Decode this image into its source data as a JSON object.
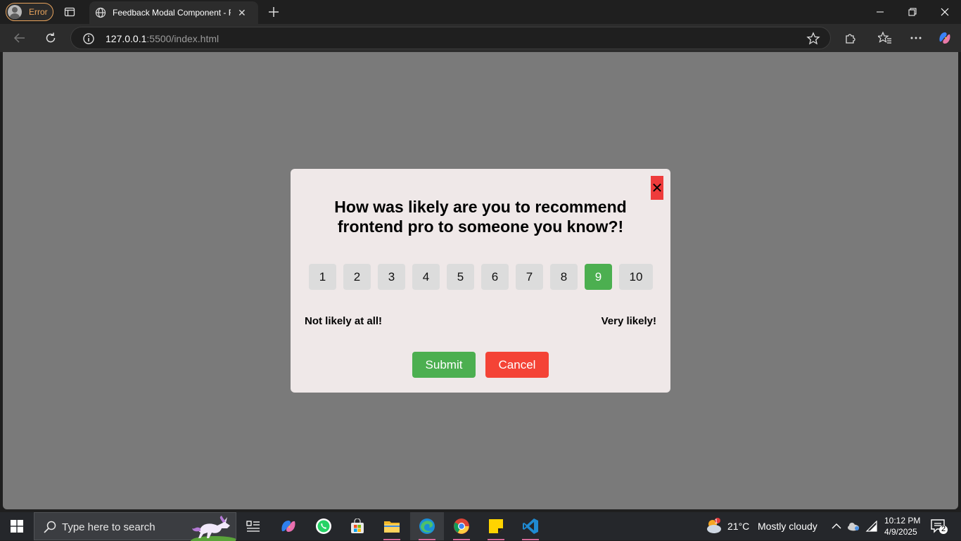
{
  "browser": {
    "profile_label": "Error",
    "tab_title": "Feedback Modal Component - Frontend Pro",
    "address_host": "127.0.0.1",
    "address_rest": ":5500/index.html"
  },
  "modal": {
    "close_label": "✕",
    "title": "How was likely are you to recommend frontend pro to someone you know?!",
    "ratings": [
      "1",
      "2",
      "3",
      "4",
      "5",
      "6",
      "7",
      "8",
      "9",
      "10"
    ],
    "selected_rating": "9",
    "label_low": "Not likely at all!",
    "label_high": "Very likely!",
    "submit_label": "Submit",
    "cancel_label": "Cancel"
  },
  "taskbar": {
    "search_placeholder": "Type here to search",
    "weather_temp": "21°C",
    "weather_desc": "Mostly cloudy",
    "weather_badge": "1",
    "time": "10:12 PM",
    "date": "4/9/2025",
    "notification_count": "2"
  },
  "colors": {
    "selected_rating": "#4caf50",
    "submit": "#4caf50",
    "cancel": "#f44336",
    "close": "#ee3b3b",
    "overlay": "#7a7a7a",
    "modal_bg": "#efe8e8"
  }
}
